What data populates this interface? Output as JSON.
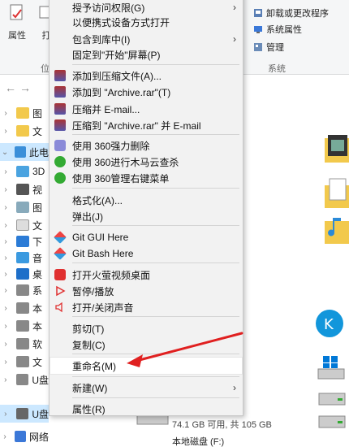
{
  "ribbon": {
    "properties_label": "属性",
    "open_label_fragment": "打",
    "group_left_fragment": "位",
    "uninstall_label": "卸载或更改程序",
    "system_props_label": "系统属性",
    "manage_label": "管理",
    "system_group_label": "系统"
  },
  "tree": {
    "items": [
      {
        "label": "图",
        "chev": "›"
      },
      {
        "label": "文",
        "chev": "›"
      },
      {
        "label": "此电",
        "chev": "⌄"
      },
      {
        "label": "3D",
        "chev": "›"
      },
      {
        "label": "视",
        "chev": "›"
      },
      {
        "label": "图",
        "chev": "›"
      },
      {
        "label": "文",
        "chev": "›"
      },
      {
        "label": "下",
        "chev": "›"
      },
      {
        "label": "音",
        "chev": "›"
      },
      {
        "label": "桌",
        "chev": "›"
      },
      {
        "label": "系",
        "chev": "›"
      },
      {
        "label": "本",
        "chev": "›"
      },
      {
        "label": "本",
        "chev": "›"
      },
      {
        "label": "软",
        "chev": "›"
      },
      {
        "label": "文",
        "chev": "›"
      },
      {
        "label": "U盘",
        "chev": "›"
      },
      {
        "label": "U盘",
        "chev": "›"
      },
      {
        "label": "网络",
        "chev": "›"
      }
    ]
  },
  "menu": {
    "items": [
      {
        "label": "授予访问权限(G)",
        "sub": true
      },
      {
        "label": "以便携式设备方式打开",
        "sub": false
      },
      {
        "label": "包含到库中(I)",
        "sub": true
      },
      {
        "label": "固定到\"开始\"屏幕(P)",
        "sub": false
      },
      {
        "label": "添加到压缩文件(A)...",
        "sub": false
      },
      {
        "label": "添加到 \"Archive.rar\"(T)",
        "sub": false
      },
      {
        "label": "压缩并 E-mail...",
        "sub": false
      },
      {
        "label": "压缩到 \"Archive.rar\" 并 E-mail",
        "sub": false
      },
      {
        "label": "使用 360强力删除",
        "sub": false
      },
      {
        "label": "使用 360进行木马云查杀",
        "sub": false
      },
      {
        "label": "使用 360管理右键菜单",
        "sub": false
      },
      {
        "label": "格式化(A)...",
        "sub": false
      },
      {
        "label": "弹出(J)",
        "sub": false
      },
      {
        "label": "Git GUI Here",
        "sub": false
      },
      {
        "label": "Git Bash Here",
        "sub": false
      },
      {
        "label": "打开火萤视频桌面",
        "sub": false
      },
      {
        "label": "暂停/播放",
        "sub": false
      },
      {
        "label": "打开/关闭声音",
        "sub": false
      },
      {
        "label": "剪切(T)",
        "sub": false
      },
      {
        "label": "复制(C)",
        "sub": false
      },
      {
        "label": "重命名(M)",
        "sub": false
      },
      {
        "label": "新建(W)",
        "sub": true
      },
      {
        "label": "属性(R)",
        "sub": false
      }
    ],
    "submenu_glyph": "›"
  },
  "drive": {
    "size_text": "74.1 GB 可用, 共 105 GB",
    "name": "本地磁盘 (F:)"
  },
  "colors": {
    "menu_bg": "#f2f2f2",
    "highlight": "#ffffff",
    "arrow_red": "#e02020",
    "tree_selected": "#cce8ff"
  }
}
